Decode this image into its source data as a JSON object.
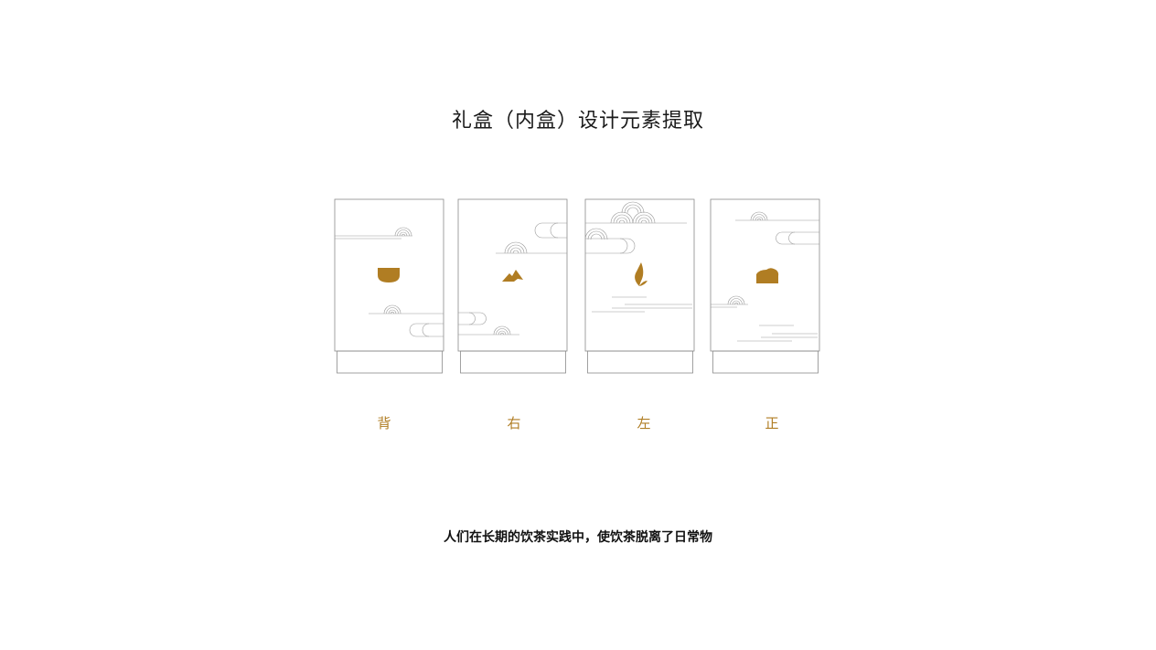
{
  "title": "礼盒（内盒）设计元素提取",
  "panels": [
    {
      "label": "背",
      "motif": "tea-bowl-icon"
    },
    {
      "label": "右",
      "motif": "mountain-icon"
    },
    {
      "label": "左",
      "motif": "tea-leaf-icon"
    },
    {
      "label": "正",
      "motif": "tea-brick-icon"
    }
  ],
  "caption": "人们在长期的饮茶实践中，使饮茶脱离了日常物",
  "colors": {
    "accent": "#b07d23",
    "line": "#7a7a7a",
    "title": "#1a1a1a"
  }
}
